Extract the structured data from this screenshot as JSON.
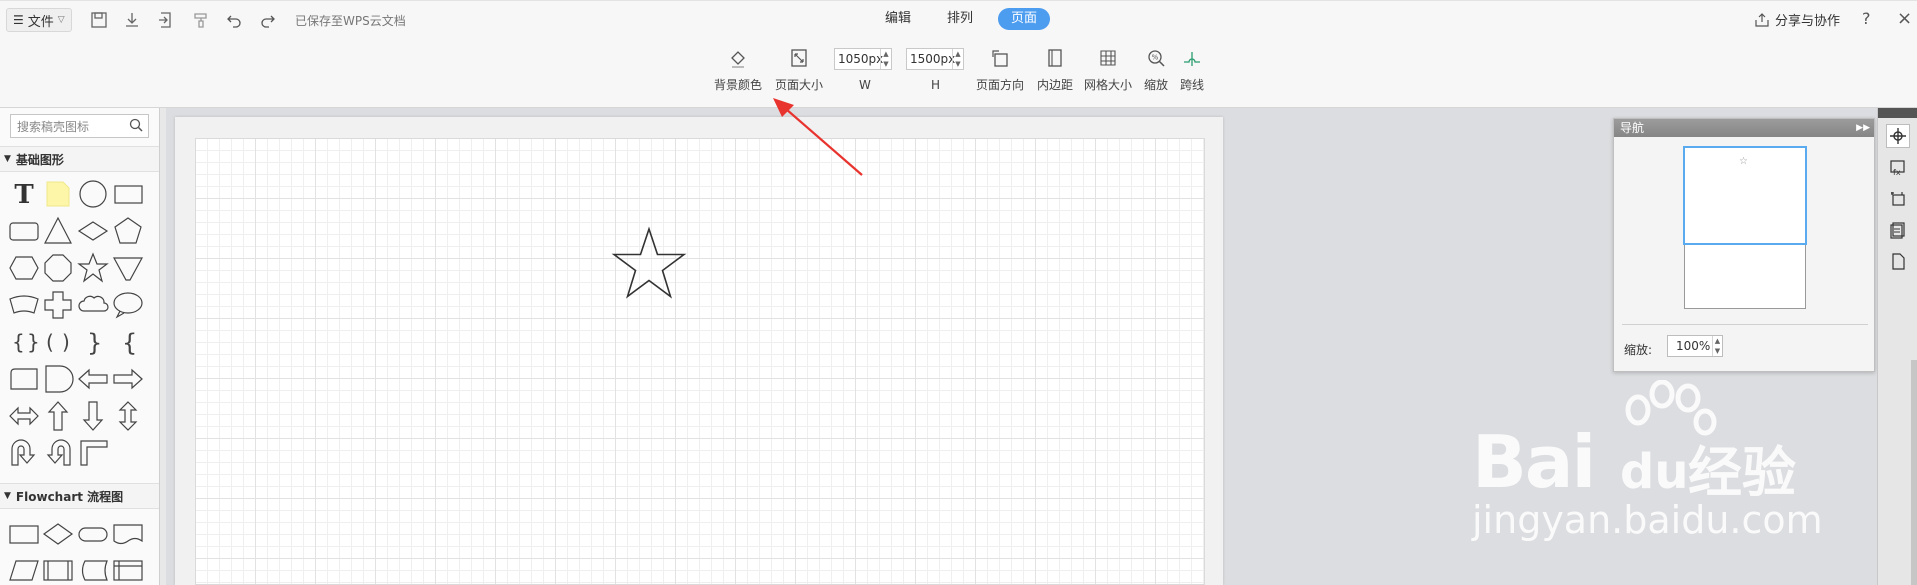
{
  "header": {
    "file_label": "文件",
    "saved_status": "已保存至WPS云文档",
    "tabs": [
      {
        "label": "编辑",
        "active": false
      },
      {
        "label": "排列",
        "active": false
      },
      {
        "label": "页面",
        "active": true
      }
    ],
    "share_label": "分享与协作",
    "help": "?",
    "close": "×"
  },
  "toolbar": {
    "background_color": "背景颜色",
    "page_size": "页面大小",
    "width_value": "1050px",
    "width_label": "W",
    "height_value": "1500px",
    "height_label": "H",
    "orientation": "页面方向",
    "margin": "内边距",
    "grid_size": "网格大小",
    "zoom": "缩放",
    "jump_line": "跨线"
  },
  "sidebar": {
    "search_placeholder": "搜索稿壳图标",
    "sections": [
      {
        "title": "基础图形"
      },
      {
        "title": "Flowchart 流程图"
      }
    ]
  },
  "navigator": {
    "title": "导航",
    "zoom_label": "缩放:",
    "zoom_value": "100%"
  },
  "watermark": {
    "brand": "Bai",
    "brand_suffix": "du",
    "cn": "经验",
    "url": "jingyan.baidu.com"
  },
  "colors": {
    "accent": "#4c9cf0",
    "annotation_arrow": "#e8332e"
  }
}
